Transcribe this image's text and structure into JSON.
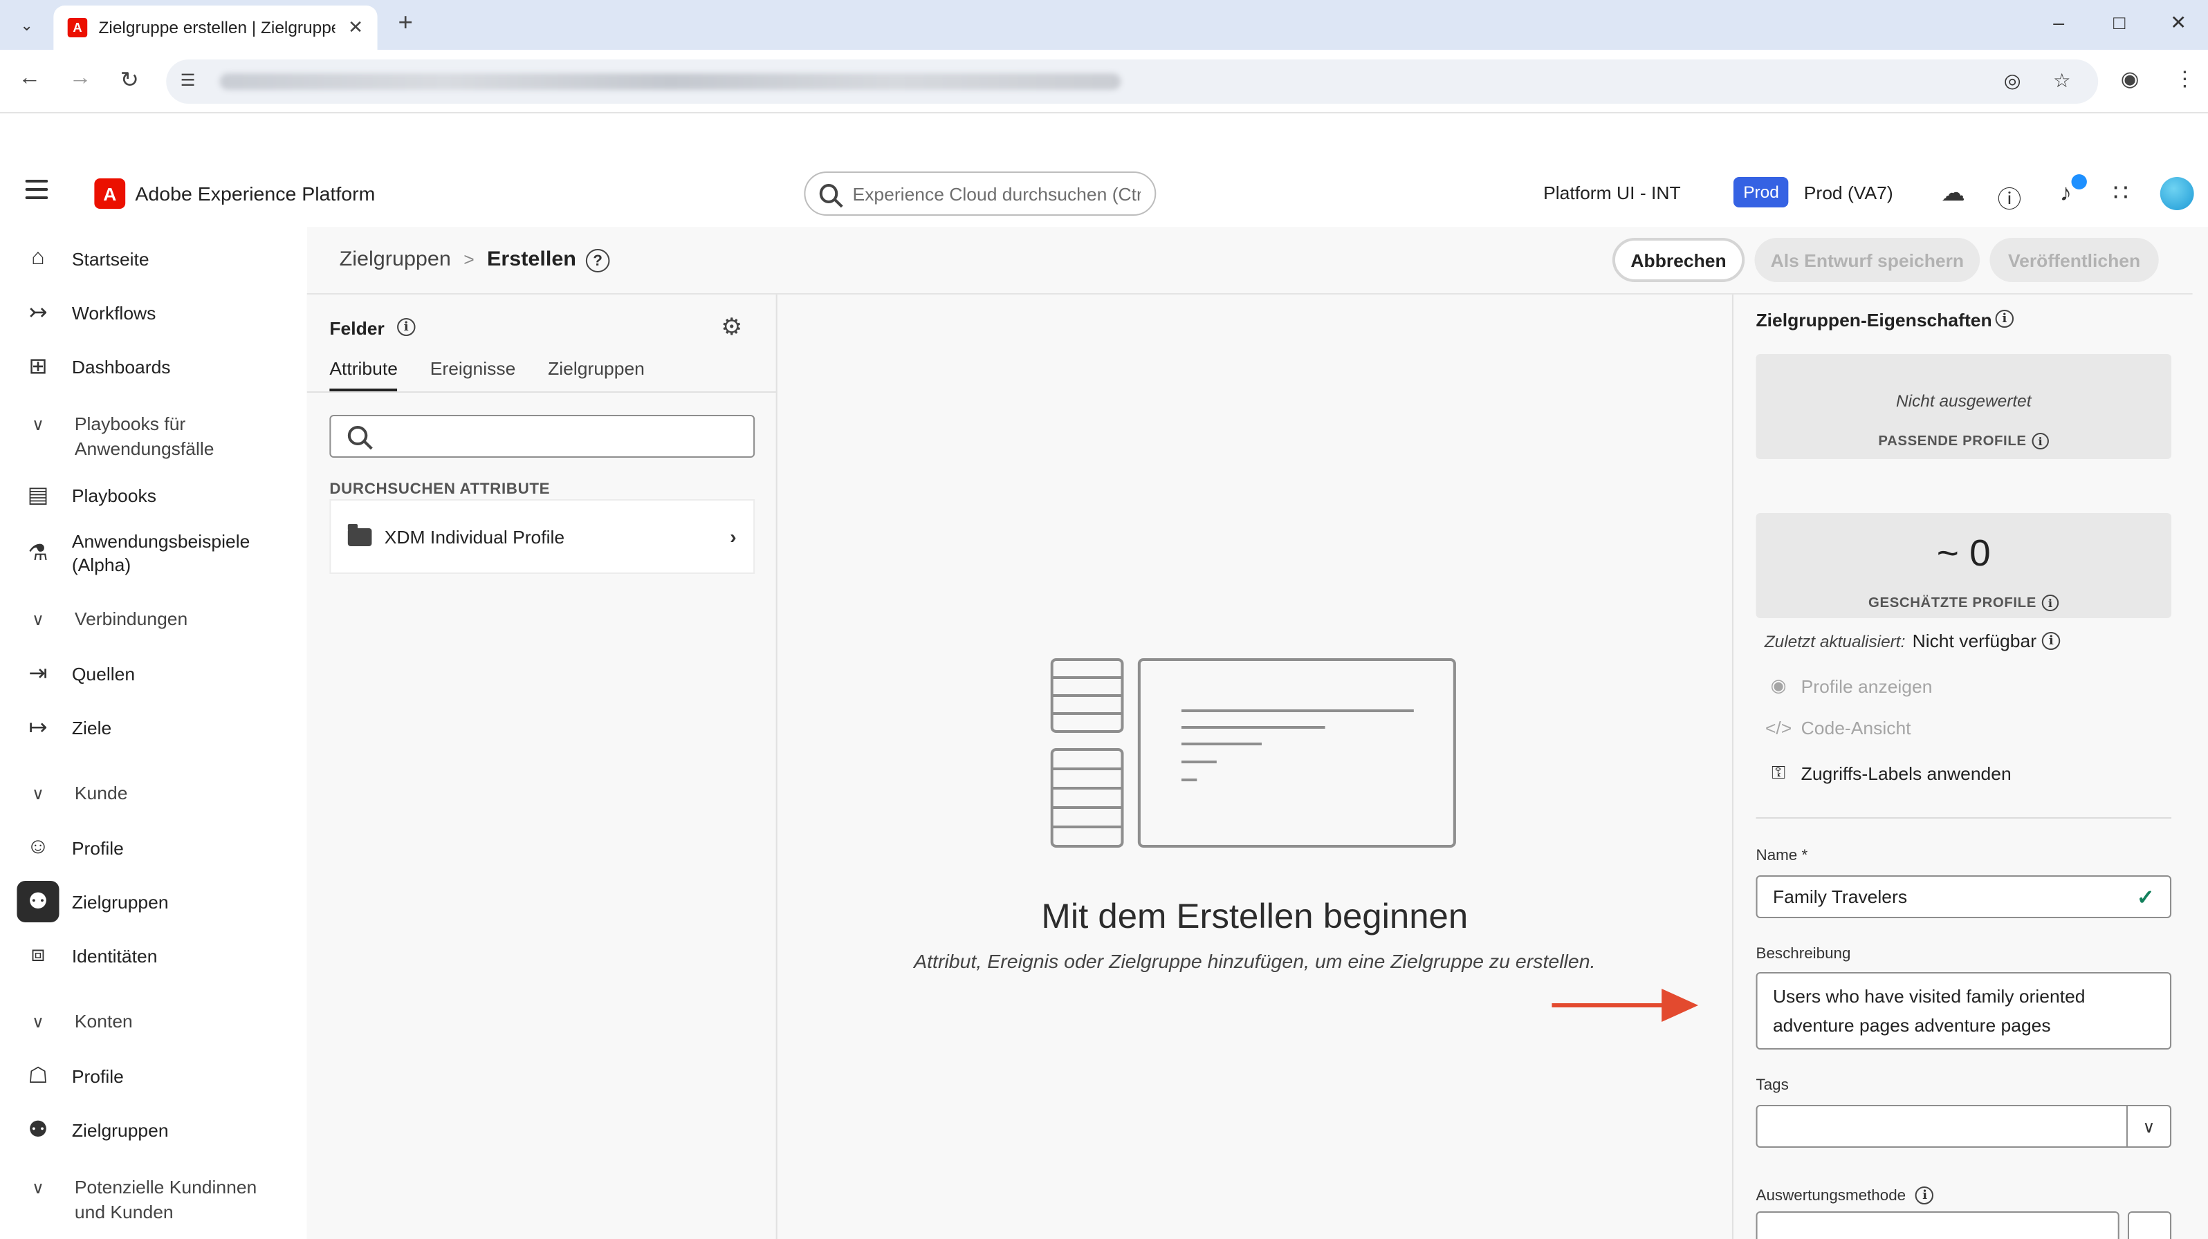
{
  "browser": {
    "tab_title": "Zielgruppe erstellen | Zielgruppe",
    "favicon": "A"
  },
  "header": {
    "app_name": "Adobe Experience Platform",
    "search_placeholder": "Experience Cloud durchsuchen (Ctr...",
    "org": "Platform UI - INT",
    "sandbox_badge": "Prod",
    "sandbox_name": "Prod (VA7)",
    "brand_color": "#eb1000",
    "badge_color": "#3562e3"
  },
  "sidebar": {
    "items": [
      {
        "label": "Startseite",
        "icon": "home-icon"
      },
      {
        "label": "Workflows",
        "icon": "workflows-icon"
      },
      {
        "label": "Dashboards",
        "icon": "dashboards-icon"
      },
      {
        "label": "Playbooks für Anwendungsfälle",
        "icon": "chevron-down-icon"
      },
      {
        "label": "Playbooks",
        "icon": "playbooks-icon"
      },
      {
        "label": "Anwendungsbeispiele (Alpha)",
        "icon": "flask-icon"
      },
      {
        "label": "Verbindungen",
        "icon": "chevron-down-icon"
      },
      {
        "label": "Quellen",
        "icon": "sources-icon"
      },
      {
        "label": "Ziele",
        "icon": "destinations-icon"
      },
      {
        "label": "Kunde",
        "icon": "chevron-down-icon"
      },
      {
        "label": "Profile",
        "icon": "profile-icon"
      },
      {
        "label": "Zielgruppen",
        "icon": "audiences-icon"
      },
      {
        "label": "Identitäten",
        "icon": "identities-icon"
      },
      {
        "label": "Konten",
        "icon": "chevron-down-icon"
      },
      {
        "label": "Profile",
        "icon": "account-profile-icon"
      },
      {
        "label": "Zielgruppen",
        "icon": "account-audiences-icon"
      },
      {
        "label": "Potenzielle Kundinnen und Kunden",
        "icon": "chevron-down-icon"
      }
    ]
  },
  "breadcrumb": {
    "parent": "Zielgruppen",
    "separator": ">",
    "current": "Erstellen"
  },
  "actions": {
    "cancel": "Abbrechen",
    "save_draft": "Als Entwurf speichern",
    "publish": "Veröffentlichen"
  },
  "fields": {
    "title": "Felder",
    "tabs": [
      "Attribute",
      "Ereignisse",
      "Zielgruppen"
    ],
    "search_value": "",
    "section_label": "DURCHSUCHEN ATTRIBUTE",
    "rows": [
      {
        "label": "XDM Individual Profile"
      }
    ]
  },
  "canvas": {
    "title": "Mit dem Erstellen beginnen",
    "subtitle": "Attribut, Ereignis oder Zielgruppe hinzufügen, um eine Zielgruppe zu erstellen."
  },
  "properties": {
    "title": "Zielgruppen-Eigenschaften",
    "matching_value": "Nicht ausgewertet",
    "matching_label": "PASSENDE PROFILE",
    "estimated_value": "~ 0",
    "estimated_label": "GESCHÄTZTE PROFILE",
    "updated_label": "Zuletzt aktualisiert:",
    "updated_value": "Nicht verfügbar",
    "links": {
      "view_profiles": "Profile anzeigen",
      "code_view": "Code-Ansicht",
      "access_labels": "Zugriffs-Labels anwenden"
    },
    "name_label": "Name",
    "required_mark": "*",
    "name_value": "Family Travelers",
    "description_label": "Beschreibung",
    "description_value": "Users who have visited family oriented adventure pages adventure pages",
    "tags_label": "Tags",
    "tags_value": "",
    "eval_label": "Auswertungsmethode",
    "success_color": "#12805c",
    "arrow_color": "#e34a2f"
  }
}
